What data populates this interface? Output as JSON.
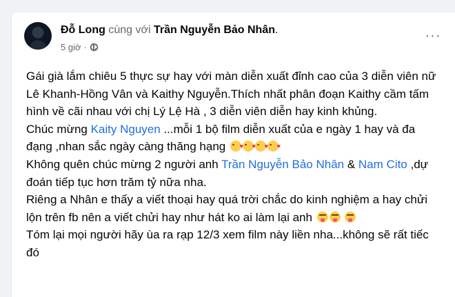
{
  "post": {
    "author": "Đỗ Long",
    "with_text": "cùng với",
    "tagged": "Trần Nguyễn Bảo Nhân",
    "tagged_suffix": ".",
    "time": "5 giờ",
    "dot": "·",
    "more_label": "···",
    "privacy_icon": "globe-icon",
    "menu_icon": "more-options-icon"
  },
  "content": {
    "p1": "Gái già lắm chiêu 5 thực sự hay với màn diễn xuất đỉnh cao của 3 diễn viên nữ Lê Khanh-Hồng Vân và Kaithy Nguyễn.Thích nhất phân đoạn Kaithy cầm tấm hình về cãi nhau với chị Lý Lệ Hà , 3 diễn viên diễn hay kinh khủng.",
    "p2_pre": "Chúc mừng ",
    "p2_link": "Kaity Nguyen",
    "p2_post": " ...mỗi 1 bộ film diễn xuất của e ngày 1 hay và đa đạng ,nhan sắc ngày càng thăng hạng",
    "p3_pre": "Không quên chúc mừng 2 người anh ",
    "p3_link1": "Trần Nguyễn Bảo Nhân",
    "p3_mid": " & ",
    "p3_link2": "Nam Cito",
    "p3_post": " ,dự đoán tiếp tục hơn trăm tỷ nữa nha.",
    "p4": "Riêng a Nhân e thấy a viết thoại hay quá trời chắc do kinh nghiệm a hay chửi lộn trên fb nên a viết chửi hay như hát ko ai làm lại anh ",
    "p5": "Tóm lại mọi người hãy ùa ra rạp 12/3 xem film này liền nha...không sẽ rất tiếc đó"
  },
  "colors": {
    "link": "#216fdb",
    "text": "#050505",
    "secondary": "#65676b",
    "background": "#f0f2f5"
  }
}
